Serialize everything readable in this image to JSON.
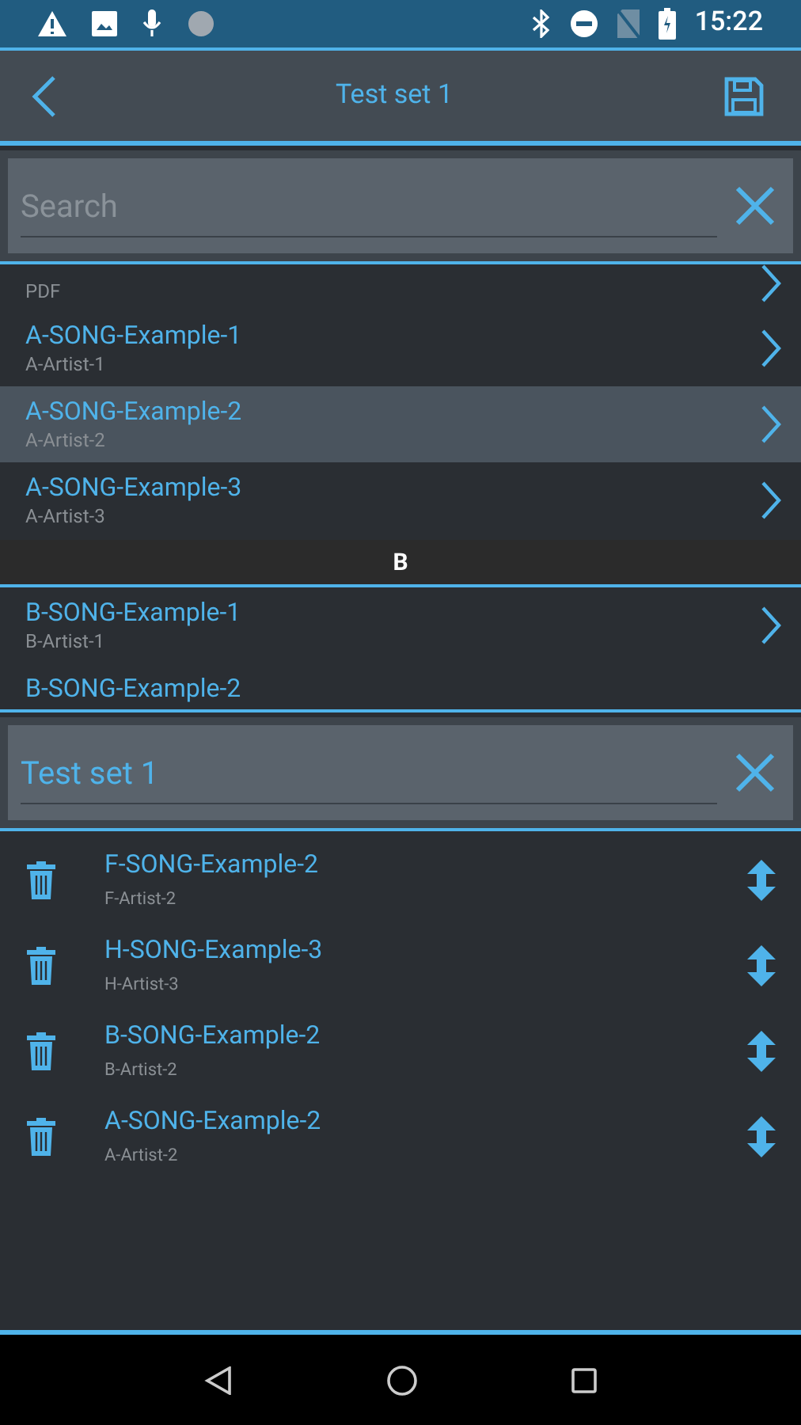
{
  "status_bar": {
    "time": "15:22"
  },
  "header": {
    "title": "Test set 1"
  },
  "search": {
    "placeholder": "Search"
  },
  "song_list": [
    {
      "kind": "song_cut_top",
      "subtitle": "PDF",
      "selected": false
    },
    {
      "kind": "song",
      "title": "A-SONG-Example-1",
      "subtitle": "A-Artist-1",
      "selected": false
    },
    {
      "kind": "song",
      "title": "A-SONG-Example-2",
      "subtitle": "A-Artist-2",
      "selected": true
    },
    {
      "kind": "song",
      "title": "A-SONG-Example-3",
      "subtitle": "A-Artist-3",
      "selected": false
    },
    {
      "kind": "section",
      "title": "B"
    },
    {
      "kind": "song",
      "title": "B-SONG-Example-1",
      "subtitle": "B-Artist-1",
      "selected": false
    },
    {
      "kind": "song_cut_bottom",
      "title": "B-SONG-Example-2",
      "selected": false
    }
  ],
  "set_name": {
    "value": "Test set 1"
  },
  "set_items": [
    {
      "title": "F-SONG-Example-2",
      "subtitle": "F-Artist-2"
    },
    {
      "title": "H-SONG-Example-3",
      "subtitle": "H-Artist-3"
    },
    {
      "title": "B-SONG-Example-2",
      "subtitle": "B-Artist-2"
    },
    {
      "title": "A-SONG-Example-2",
      "subtitle": "A-Artist-2"
    }
  ]
}
